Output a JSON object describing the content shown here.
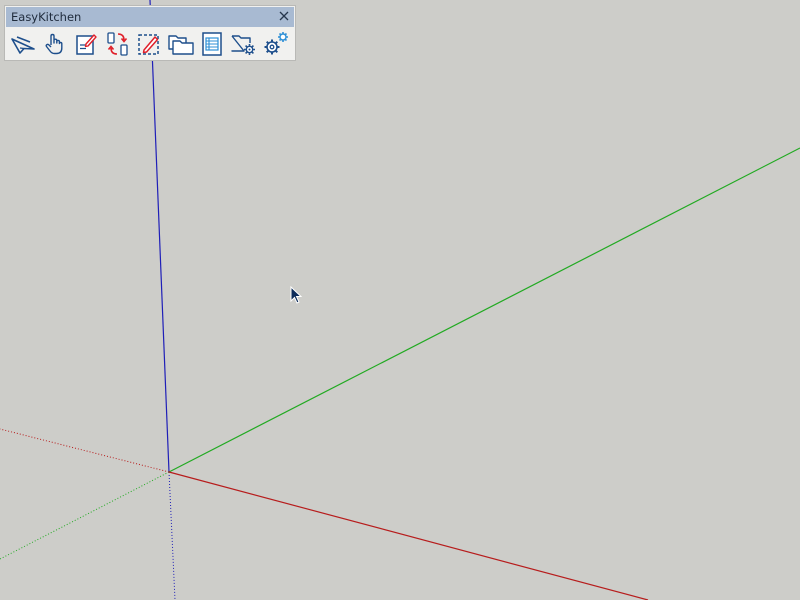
{
  "window": {
    "background": "#cdcdc9"
  },
  "toolbar": {
    "title": "EasyKitchen",
    "close_icon": "close-icon",
    "buttons": [
      {
        "name": "select-tool-button",
        "icon": "arrow-select-icon"
      },
      {
        "name": "pan-tool-button",
        "icon": "hand-icon"
      },
      {
        "name": "edit-component-button",
        "icon": "edit-sheet-icon"
      },
      {
        "name": "swap-components-button",
        "icon": "swap-arrows-icon"
      },
      {
        "name": "edit-selection-button",
        "icon": "dashed-edit-icon"
      },
      {
        "name": "open-library-button",
        "icon": "folders-icon"
      },
      {
        "name": "report-button",
        "icon": "list-sheet-icon"
      },
      {
        "name": "folder-settings-button",
        "icon": "folder-gear-icon"
      },
      {
        "name": "settings-button",
        "icon": "gears-icon"
      }
    ]
  },
  "axes": {
    "red": "#b71c1c",
    "green": "#22aa22",
    "blue": "#1f1fb8"
  }
}
